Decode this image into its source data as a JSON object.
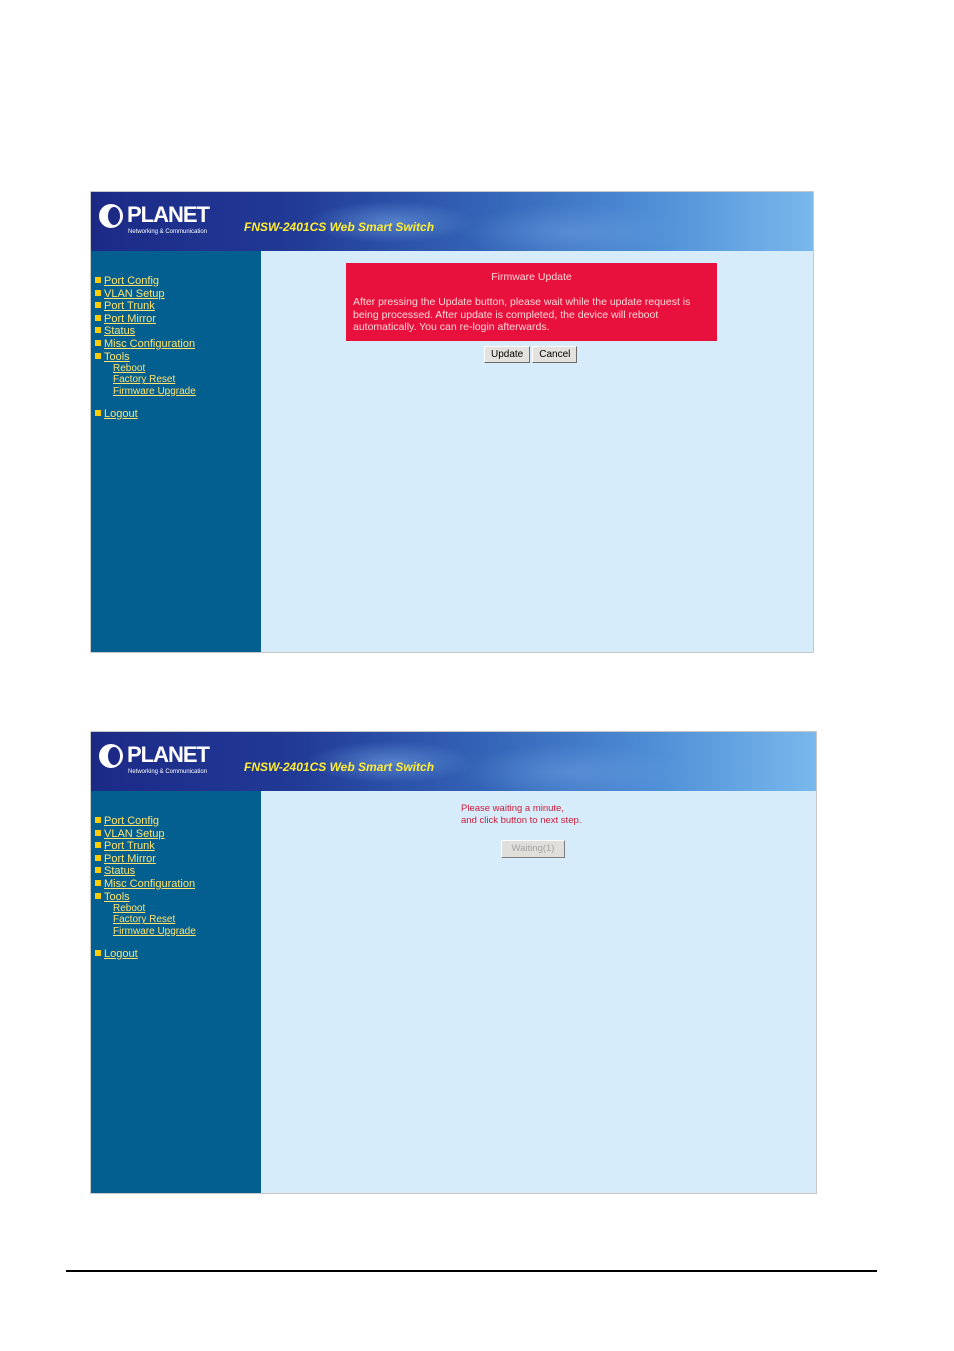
{
  "brand": {
    "logo_text": "PLANET",
    "logo_tagline": "Networking & Communication",
    "product_title": "FNSW-2401CS Web Smart Switch"
  },
  "nav": {
    "items": [
      "Port Config",
      "VLAN Setup",
      "Port Trunk",
      "Port Mirror",
      "Status",
      "Misc Configuration",
      "Tools"
    ],
    "tools_sub": [
      "Reboot",
      "Factory Reset",
      "Firmware Upgrade"
    ],
    "logout": "Logout"
  },
  "firmware_update": {
    "title": "Firmware Update",
    "message": "After pressing the Update button, please wait while the update request is being processed. After update is completed, the device will reboot automatically. You can re-login afterwards.",
    "update_button": "Update",
    "cancel_button": "Cancel"
  },
  "waiting_page": {
    "line1": "Please waiting a minute,",
    "line2": "and click button to next step.",
    "waiting_button": "Waiting(1)"
  },
  "colors": {
    "banner_dark": "#1c2a86",
    "sidebar": "#045f91",
    "content_bg": "#d6ecfb",
    "link": "#ffe36e",
    "product_title": "#ffee33",
    "alert_box": "#e8113d",
    "wait_text": "#cc1c3a"
  }
}
